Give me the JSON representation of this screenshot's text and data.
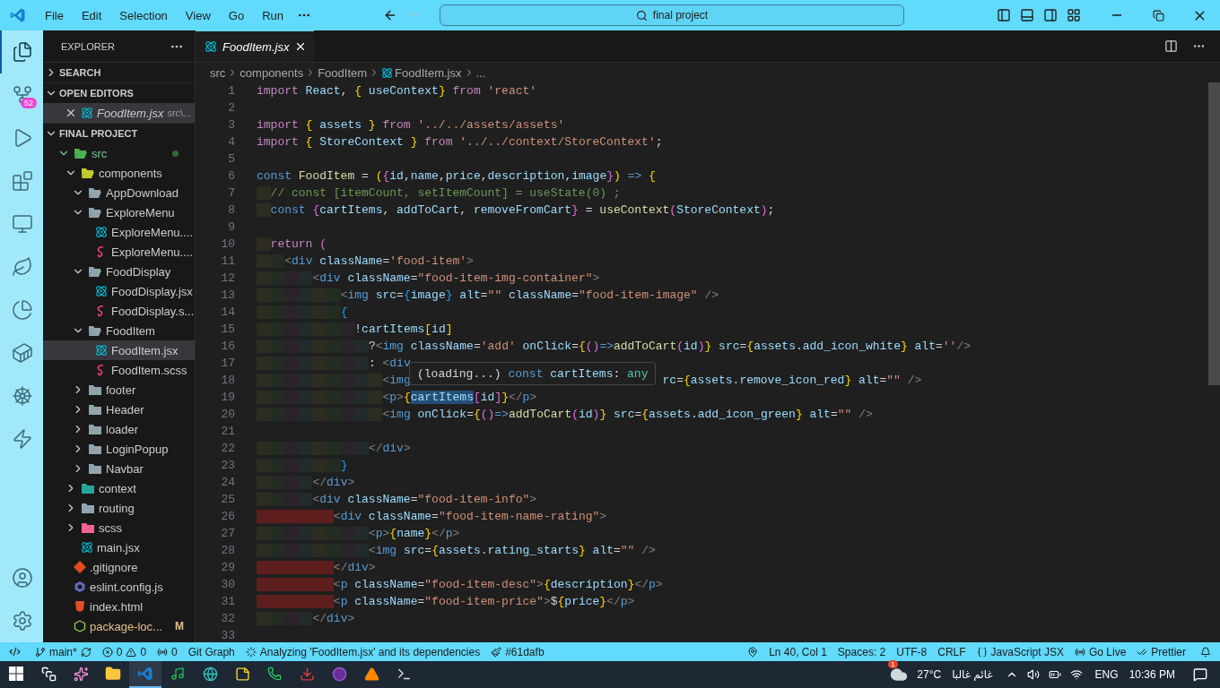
{
  "title_bar": {
    "menu": [
      "File",
      "Edit",
      "Selection",
      "View",
      "Go",
      "Run"
    ],
    "search": "final project"
  },
  "activity_bar": [
    {
      "kind": "explorer",
      "selected": true
    },
    {
      "kind": "source-control",
      "selected": false,
      "badge": "52"
    },
    {
      "kind": "run-debug",
      "selected": false
    },
    {
      "kind": "extensions",
      "selected": false
    },
    {
      "kind": "remote",
      "selected": false
    },
    {
      "kind": "leaf",
      "selected": false
    },
    {
      "kind": "pie",
      "selected": false
    },
    {
      "kind": "docker",
      "selected": false
    },
    {
      "kind": "wheel",
      "selected": false
    },
    {
      "kind": "bolt",
      "selected": false
    },
    {
      "kind": "account",
      "selected": false
    },
    {
      "kind": "settings",
      "selected": false
    }
  ],
  "sidebar": {
    "title": "EXPLORER",
    "search_section": {
      "title": "SEARCH",
      "expanded": false
    },
    "open_editors": {
      "title": "OPEN EDITORS",
      "expanded": true,
      "items": [
        {
          "label": "FoodItem.jsx",
          "path": "src\\...",
          "kind": "react",
          "selected": true
        }
      ]
    },
    "project": {
      "title": "FINAL PROJECT",
      "expanded": true,
      "tree": [
        {
          "label": "src",
          "kind": "folder-src",
          "expanded": true,
          "selected": false,
          "dot": true,
          "children": [
            {
              "label": "components",
              "kind": "folder-components",
              "expanded": true,
              "selected": false,
              "children": [
                {
                  "label": "AppDownload",
                  "kind": "folder",
                  "expanded": true,
                  "selected": false
                },
                {
                  "label": "ExploreMenu",
                  "kind": "folder",
                  "expanded": true,
                  "selected": false,
                  "children": [
                    {
                      "label": "ExploreMenu....",
                      "kind": "react",
                      "selected": false
                    },
                    {
                      "label": "ExploreMenu....",
                      "kind": "sass",
                      "selected": false
                    }
                  ]
                },
                {
                  "label": "FoodDisplay",
                  "kind": "folder",
                  "expanded": true,
                  "selected": false,
                  "children": [
                    {
                      "label": "FoodDisplay.jsx",
                      "kind": "react",
                      "selected": false
                    },
                    {
                      "label": "FoodDisplay.s...",
                      "kind": "sass",
                      "selected": false
                    }
                  ]
                },
                {
                  "label": "FoodItem",
                  "kind": "folder",
                  "expanded": true,
                  "selected": false,
                  "children": [
                    {
                      "label": "FoodItem.jsx",
                      "kind": "react",
                      "selected": true
                    },
                    {
                      "label": "FoodItem.scss",
                      "kind": "sass",
                      "selected": false
                    }
                  ]
                },
                {
                  "label": "footer",
                  "kind": "folder",
                  "expanded": false,
                  "selected": false
                },
                {
                  "label": "Header",
                  "kind": "folder",
                  "expanded": false,
                  "selected": false
                },
                {
                  "label": "loader",
                  "kind": "folder",
                  "expanded": false,
                  "selected": false
                },
                {
                  "label": "LoginPopup",
                  "kind": "folder",
                  "expanded": false,
                  "selected": false
                },
                {
                  "label": "Navbar",
                  "kind": "folder",
                  "expanded": false,
                  "selected": false
                }
              ]
            },
            {
              "label": "context",
              "kind": "folder-context",
              "expanded": false,
              "selected": false
            },
            {
              "label": "routing",
              "kind": "folder",
              "expanded": false,
              "selected": false
            },
            {
              "label": "scss",
              "kind": "folder-sass",
              "expanded": false,
              "selected": false
            },
            {
              "label": "main.jsx",
              "kind": "react",
              "selected": false
            }
          ]
        },
        {
          "label": ".gitignore",
          "kind": "git",
          "selected": false
        },
        {
          "label": "eslint.config.js",
          "kind": "eslint",
          "selected": false
        },
        {
          "label": "index.html",
          "kind": "html",
          "selected": false
        },
        {
          "label": "package-loc...",
          "kind": "json",
          "selected": false,
          "badge": "M"
        }
      ]
    }
  },
  "editor": {
    "tabs": [
      {
        "label": "FoodItem.jsx",
        "selected": true
      }
    ],
    "breadcrumbs": [
      {
        "label": "src",
        "kind": "folder"
      },
      {
        "label": "components",
        "kind": "folder"
      },
      {
        "label": "FoodItem",
        "kind": "folder"
      },
      {
        "label": "FoodItem.jsx",
        "kind": "file"
      },
      {
        "label": "...",
        "kind": "more"
      }
    ],
    "lines": [
      {
        "number": "1",
        "tokens": [
          {
            "kind": "kw",
            "text": "import"
          },
          {
            "kind": "id",
            "text": " React"
          },
          {
            "kind": "pl",
            "text": ", "
          },
          {
            "kind": "b1",
            "text": "{"
          },
          {
            "kind": "id",
            "text": " useContext"
          },
          {
            "kind": "b1",
            "text": "}"
          },
          {
            "kind": "kw",
            "text": " from"
          },
          {
            "kind": "str",
            "text": " 'react'"
          }
        ]
      },
      {
        "number": "2"
      },
      {
        "number": "3",
        "tokens": [
          {
            "kind": "kw",
            "text": "import"
          },
          {
            "kind": "b1",
            "text": " {"
          },
          {
            "kind": "id",
            "text": " assets"
          },
          {
            "kind": "b1",
            "text": " }"
          },
          {
            "kind": "kw",
            "text": " from"
          },
          {
            "kind": "str",
            "text": " '../../assets/assets'"
          }
        ]
      },
      {
        "number": "4",
        "tokens": [
          {
            "kind": "kw",
            "text": "import"
          },
          {
            "kind": "b1",
            "text": " {"
          },
          {
            "kind": "id",
            "text": " StoreContext"
          },
          {
            "kind": "b1",
            "text": " }"
          },
          {
            "kind": "kw",
            "text": " from"
          },
          {
            "kind": "str",
            "text": " '../../context/StoreContext'"
          },
          {
            "kind": "pl",
            "text": ";"
          }
        ]
      },
      {
        "number": "5"
      },
      {
        "number": "6",
        "tokens": [
          {
            "kind": "st",
            "text": "const"
          },
          {
            "kind": "fn",
            "text": " FoodItem"
          },
          {
            "kind": "pl",
            "text": " = "
          },
          {
            "kind": "b1",
            "text": "("
          },
          {
            "kind": "b2",
            "text": "{"
          },
          {
            "kind": "id",
            "text": "id"
          },
          {
            "kind": "pl",
            "text": ","
          },
          {
            "kind": "id",
            "text": "name"
          },
          {
            "kind": "pl",
            "text": ","
          },
          {
            "kind": "id",
            "text": "price"
          },
          {
            "kind": "pl",
            "text": ","
          },
          {
            "kind": "id",
            "text": "description"
          },
          {
            "kind": "pl",
            "text": ","
          },
          {
            "kind": "id",
            "text": "image"
          },
          {
            "kind": "b2",
            "text": "}"
          },
          {
            "kind": "b1",
            "text": ")"
          },
          {
            "kind": "st",
            "text": " =>"
          },
          {
            "kind": "b1",
            "text": " {"
          }
        ]
      },
      {
        "number": "7",
        "tokens": [
          {
            "kind": "cm",
            "text": "  // const [itemCount, setItemCount] = useState(0) ;"
          }
        ]
      },
      {
        "number": "8",
        "tokens": [
          {
            "kind": "st",
            "text": "  const"
          },
          {
            "kind": "b2",
            "text": " {"
          },
          {
            "kind": "id",
            "text": "cartItems"
          },
          {
            "kind": "pl",
            "text": ", "
          },
          {
            "kind": "id",
            "text": "addToCart"
          },
          {
            "kind": "pl",
            "text": ", "
          },
          {
            "kind": "id",
            "text": "removeFromCart"
          },
          {
            "kind": "b2",
            "text": "}"
          },
          {
            "kind": "pl",
            "text": " = "
          },
          {
            "kind": "fn",
            "text": "useContext"
          },
          {
            "kind": "b2",
            "text": "("
          },
          {
            "kind": "id",
            "text": "StoreContext"
          },
          {
            "kind": "b2",
            "text": ")"
          },
          {
            "kind": "pl",
            "text": ";"
          }
        ]
      },
      {
        "number": "9"
      },
      {
        "number": "10",
        "tokens": [
          {
            "kind": "kw",
            "text": "  return"
          },
          {
            "kind": "b2",
            "text": " ("
          }
        ]
      },
      {
        "number": "11",
        "tokens": [
          {
            "kind": "tg",
            "text": "    <"
          },
          {
            "kind": "tn",
            "text": "div"
          },
          {
            "kind": "at",
            "text": " className"
          },
          {
            "kind": "pl",
            "text": "="
          },
          {
            "kind": "str",
            "text": "'food-item'"
          },
          {
            "kind": "tg",
            "text": ">"
          }
        ]
      },
      {
        "number": "12",
        "tokens": [
          {
            "kind": "tg",
            "text": "        <"
          },
          {
            "kind": "tn",
            "text": "div"
          },
          {
            "kind": "at",
            "text": " className"
          },
          {
            "kind": "pl",
            "text": "="
          },
          {
            "kind": "str",
            "text": "\"food-item-img-container\""
          },
          {
            "kind": "tg",
            "text": ">"
          }
        ]
      },
      {
        "number": "13",
        "tokens": [
          {
            "kind": "tg",
            "text": "            <"
          },
          {
            "kind": "tn",
            "text": "img"
          },
          {
            "kind": "at",
            "text": " src"
          },
          {
            "kind": "pl",
            "text": "="
          },
          {
            "kind": "b3",
            "text": "{"
          },
          {
            "kind": "id",
            "text": "image"
          },
          {
            "kind": "b3",
            "text": "}"
          },
          {
            "kind": "at",
            "text": " alt"
          },
          {
            "kind": "pl",
            "text": "="
          },
          {
            "kind": "str",
            "text": "\"\""
          },
          {
            "kind": "at",
            "text": " className"
          },
          {
            "kind": "pl",
            "text": "="
          },
          {
            "kind": "str",
            "text": "\"food-item-image\""
          },
          {
            "kind": "tg",
            "text": " />"
          }
        ]
      },
      {
        "number": "14",
        "tokens": [
          {
            "kind": "b3",
            "text": "            {"
          }
        ]
      },
      {
        "number": "15",
        "tokens": [
          {
            "kind": "pl",
            "text": "              !"
          },
          {
            "kind": "id",
            "text": "cartItems"
          },
          {
            "kind": "b1",
            "text": "["
          },
          {
            "kind": "id",
            "text": "id"
          },
          {
            "kind": "b1",
            "text": "]"
          }
        ]
      },
      {
        "number": "16",
        "tokens": [
          {
            "kind": "pl",
            "text": "                ?"
          },
          {
            "kind": "tg",
            "text": "<"
          },
          {
            "kind": "tn",
            "text": "img"
          },
          {
            "kind": "at",
            "text": " className"
          },
          {
            "kind": "pl",
            "text": "="
          },
          {
            "kind": "str",
            "text": "'add'"
          },
          {
            "kind": "at",
            "text": " onClick"
          },
          {
            "kind": "pl",
            "text": "="
          },
          {
            "kind": "b1",
            "text": "{"
          },
          {
            "kind": "b2",
            "text": "()"
          },
          {
            "kind": "st",
            "text": "=>"
          },
          {
            "kind": "fn",
            "text": "addToCart"
          },
          {
            "kind": "b2",
            "text": "("
          },
          {
            "kind": "id",
            "text": "id"
          },
          {
            "kind": "b2",
            "text": ")"
          },
          {
            "kind": "b1",
            "text": "}"
          },
          {
            "kind": "at",
            "text": " src"
          },
          {
            "kind": "pl",
            "text": "="
          },
          {
            "kind": "b1",
            "text": "{"
          },
          {
            "kind": "id",
            "text": "assets.add_icon_white"
          },
          {
            "kind": "b1",
            "text": "}"
          },
          {
            "kind": "at",
            "text": " alt"
          },
          {
            "kind": "pl",
            "text": "="
          },
          {
            "kind": "str",
            "text": "''"
          },
          {
            "kind": "tg",
            "text": "/>"
          }
        ]
      },
      {
        "number": "17",
        "tokens": [
          {
            "kind": "pl",
            "text": "                : "
          },
          {
            "kind": "tg",
            "text": "<"
          },
          {
            "kind": "tn",
            "text": "div"
          }
        ]
      },
      {
        "number": "18",
        "tokens": [
          {
            "kind": "tg",
            "text": "                  <"
          },
          {
            "kind": "tn",
            "text": "img"
          },
          {
            "kind": "at",
            "text": "                                    rc"
          },
          {
            "kind": "pl",
            "text": "="
          },
          {
            "kind": "b1",
            "text": "{"
          },
          {
            "kind": "id",
            "text": "assets.remove_icon_red"
          },
          {
            "kind": "b1",
            "text": "}"
          },
          {
            "kind": "at",
            "text": " alt"
          },
          {
            "kind": "pl",
            "text": "="
          },
          {
            "kind": "str",
            "text": "\"\""
          },
          {
            "kind": "tg",
            "text": " />"
          }
        ]
      },
      {
        "number": "19",
        "tokens": [
          {
            "kind": "tg",
            "text": "                  <"
          },
          {
            "kind": "tn",
            "text": "p"
          },
          {
            "kind": "tg",
            "text": ">"
          },
          {
            "kind": "b1",
            "text": "{"
          },
          {
            "kind": "hl",
            "text": "cartItems"
          },
          {
            "kind": "b2",
            "text": "["
          },
          {
            "kind": "id",
            "text": "id"
          },
          {
            "kind": "b2",
            "text": "]"
          },
          {
            "kind": "b1",
            "text": "}"
          },
          {
            "kind": "tg",
            "text": "</"
          },
          {
            "kind": "tn",
            "text": "p"
          },
          {
            "kind": "tg",
            "text": ">"
          }
        ]
      },
      {
        "number": "20",
        "tokens": [
          {
            "kind": "tg",
            "text": "                  <"
          },
          {
            "kind": "tn",
            "text": "img"
          },
          {
            "kind": "at",
            "text": " onClick"
          },
          {
            "kind": "pl",
            "text": "="
          },
          {
            "kind": "b1",
            "text": "{"
          },
          {
            "kind": "b2",
            "text": "()"
          },
          {
            "kind": "st",
            "text": "=>"
          },
          {
            "kind": "fn",
            "text": "addToCart"
          },
          {
            "kind": "b2",
            "text": "("
          },
          {
            "kind": "id",
            "text": "id"
          },
          {
            "kind": "b2",
            "text": ")"
          },
          {
            "kind": "b1",
            "text": "}"
          },
          {
            "kind": "at",
            "text": " src"
          },
          {
            "kind": "pl",
            "text": "="
          },
          {
            "kind": "b1",
            "text": "{"
          },
          {
            "kind": "id",
            "text": "assets.add_icon_green"
          },
          {
            "kind": "b1",
            "text": "}"
          },
          {
            "kind": "at",
            "text": " alt"
          },
          {
            "kind": "pl",
            "text": "="
          },
          {
            "kind": "str",
            "text": "\"\""
          },
          {
            "kind": "tg",
            "text": " />"
          }
        ]
      },
      {
        "number": "21"
      },
      {
        "number": "22",
        "tokens": [
          {
            "kind": "tg",
            "text": "                </"
          },
          {
            "kind": "tn",
            "text": "div"
          },
          {
            "kind": "tg",
            "text": ">"
          }
        ]
      },
      {
        "number": "23",
        "tokens": [
          {
            "kind": "b3",
            "text": "            }"
          }
        ]
      },
      {
        "number": "24",
        "tokens": [
          {
            "kind": "tg",
            "text": "        </"
          },
          {
            "kind": "tn",
            "text": "div"
          },
          {
            "kind": "tg",
            "text": ">"
          }
        ]
      },
      {
        "number": "25",
        "tokens": [
          {
            "kind": "tg",
            "text": "        <"
          },
          {
            "kind": "tn",
            "text": "div"
          },
          {
            "kind": "at",
            "text": " className"
          },
          {
            "kind": "pl",
            "text": "="
          },
          {
            "kind": "str",
            "text": "\"food-item-info\""
          },
          {
            "kind": "tg",
            "text": ">"
          }
        ]
      },
      {
        "number": "26",
        "tokens": [
          {
            "kind": "tg",
            "text": "           <"
          },
          {
            "kind": "tn",
            "text": "div"
          },
          {
            "kind": "at",
            "text": " className"
          },
          {
            "kind": "pl",
            "text": "="
          },
          {
            "kind": "str",
            "text": "\"food-item-name-rating\""
          },
          {
            "kind": "tg",
            "text": ">"
          }
        ]
      },
      {
        "number": "27",
        "tokens": [
          {
            "kind": "tg",
            "text": "                <"
          },
          {
            "kind": "tn",
            "text": "p"
          },
          {
            "kind": "tg",
            "text": ">"
          },
          {
            "kind": "b1",
            "text": "{"
          },
          {
            "kind": "id",
            "text": "name"
          },
          {
            "kind": "b1",
            "text": "}"
          },
          {
            "kind": "tg",
            "text": "</"
          },
          {
            "kind": "tn",
            "text": "p"
          },
          {
            "kind": "tg",
            "text": ">"
          }
        ]
      },
      {
        "number": "28",
        "tokens": [
          {
            "kind": "tg",
            "text": "                <"
          },
          {
            "kind": "tn",
            "text": "img"
          },
          {
            "kind": "at",
            "text": " src"
          },
          {
            "kind": "pl",
            "text": "="
          },
          {
            "kind": "b1",
            "text": "{"
          },
          {
            "kind": "id",
            "text": "assets.rating_starts"
          },
          {
            "kind": "b1",
            "text": "}"
          },
          {
            "kind": "at",
            "text": " alt"
          },
          {
            "kind": "pl",
            "text": "="
          },
          {
            "kind": "str",
            "text": "\"\""
          },
          {
            "kind": "tg",
            "text": " />"
          }
        ]
      },
      {
        "number": "29",
        "tokens": [
          {
            "kind": "tg",
            "text": "           </"
          },
          {
            "kind": "tn",
            "text": "div"
          },
          {
            "kind": "tg",
            "text": ">"
          }
        ]
      },
      {
        "number": "30",
        "tokens": [
          {
            "kind": "tg",
            "text": "           <"
          },
          {
            "kind": "tn",
            "text": "p"
          },
          {
            "kind": "at",
            "text": " className"
          },
          {
            "kind": "pl",
            "text": "="
          },
          {
            "kind": "str",
            "text": "\"food-item-desc\""
          },
          {
            "kind": "tg",
            "text": ">"
          },
          {
            "kind": "b1",
            "text": "{"
          },
          {
            "kind": "id",
            "text": "description"
          },
          {
            "kind": "b1",
            "text": "}"
          },
          {
            "kind": "tg",
            "text": "</"
          },
          {
            "kind": "tn",
            "text": "p"
          },
          {
            "kind": "tg",
            "text": ">"
          }
        ]
      },
      {
        "number": "31",
        "tokens": [
          {
            "kind": "tg",
            "text": "           <"
          },
          {
            "kind": "tn",
            "text": "p"
          },
          {
            "kind": "at",
            "text": " className"
          },
          {
            "kind": "pl",
            "text": "="
          },
          {
            "kind": "str",
            "text": "\"food-item-price\""
          },
          {
            "kind": "tg",
            "text": ">"
          },
          {
            "kind": "pl",
            "text": "$"
          },
          {
            "kind": "b1",
            "text": "{"
          },
          {
            "kind": "id",
            "text": "price"
          },
          {
            "kind": "b1",
            "text": "}"
          },
          {
            "kind": "tg",
            "text": "</"
          },
          {
            "kind": "tn",
            "text": "p"
          },
          {
            "kind": "tg",
            "text": ">"
          }
        ]
      },
      {
        "number": "32",
        "tokens": [
          {
            "kind": "tg",
            "text": "        </"
          },
          {
            "kind": "tn",
            "text": "div"
          },
          {
            "kind": "tg",
            "text": ">"
          }
        ]
      },
      {
        "number": "33"
      }
    ],
    "hover": [
      {
        "kind": "pl",
        "text": "(loading...)"
      },
      {
        "kind": "st",
        "text": " const"
      },
      {
        "kind": "id",
        "text": " cartItems"
      },
      {
        "kind": "pl",
        "text": ": "
      },
      {
        "kind": "ty",
        "text": "any"
      }
    ]
  },
  "status_bar": {
    "left": [
      {
        "kind": "remote"
      },
      {
        "kind": "branch",
        "text": "main*"
      },
      {
        "kind": "problems",
        "errors": "0",
        "warnings": "0"
      },
      {
        "kind": "ports",
        "text": "0"
      },
      {
        "kind": "plain",
        "text": "Git Graph"
      },
      {
        "kind": "progress",
        "text": "Analyzing 'FoodItem.jsx' and its dependencies"
      },
      {
        "kind": "color",
        "text": "#61dafb"
      }
    ],
    "right": [
      {
        "kind": "location"
      },
      {
        "kind": "plain",
        "text": "Ln 40, Col 1"
      },
      {
        "kind": "plain",
        "text": "Spaces: 2"
      },
      {
        "kind": "plain",
        "text": "UTF-8"
      },
      {
        "kind": "plain",
        "text": "CRLF"
      },
      {
        "kind": "language",
        "text": "JavaScript JSX"
      },
      {
        "kind": "golive",
        "text": "Go Live"
      },
      {
        "kind": "prettier",
        "text": "Prettier"
      },
      {
        "kind": "bell"
      }
    ]
  },
  "taskbar": {
    "apps": [
      {
        "kind": "start",
        "selected": false
      },
      {
        "kind": "taskview",
        "selected": false
      },
      {
        "kind": "copilot",
        "selected": false
      },
      {
        "kind": "files",
        "selected": false
      },
      {
        "kind": "vscode",
        "selected": true
      },
      {
        "kind": "spotify",
        "selected": false
      },
      {
        "kind": "edge",
        "selected": false
      },
      {
        "kind": "sticky",
        "selected": false
      },
      {
        "kind": "whatsapp",
        "selected": false
      },
      {
        "kind": "app-red",
        "selected": false
      },
      {
        "kind": "app-purple",
        "selected": false
      },
      {
        "kind": "vlc",
        "selected": false
      },
      {
        "kind": "terminal",
        "selected": false
      }
    ],
    "weather": {
      "badge": "1",
      "temperature": "27°C",
      "condition": "غائم غالبا"
    },
    "language": "ENG",
    "time": "10:36 PM"
  }
}
